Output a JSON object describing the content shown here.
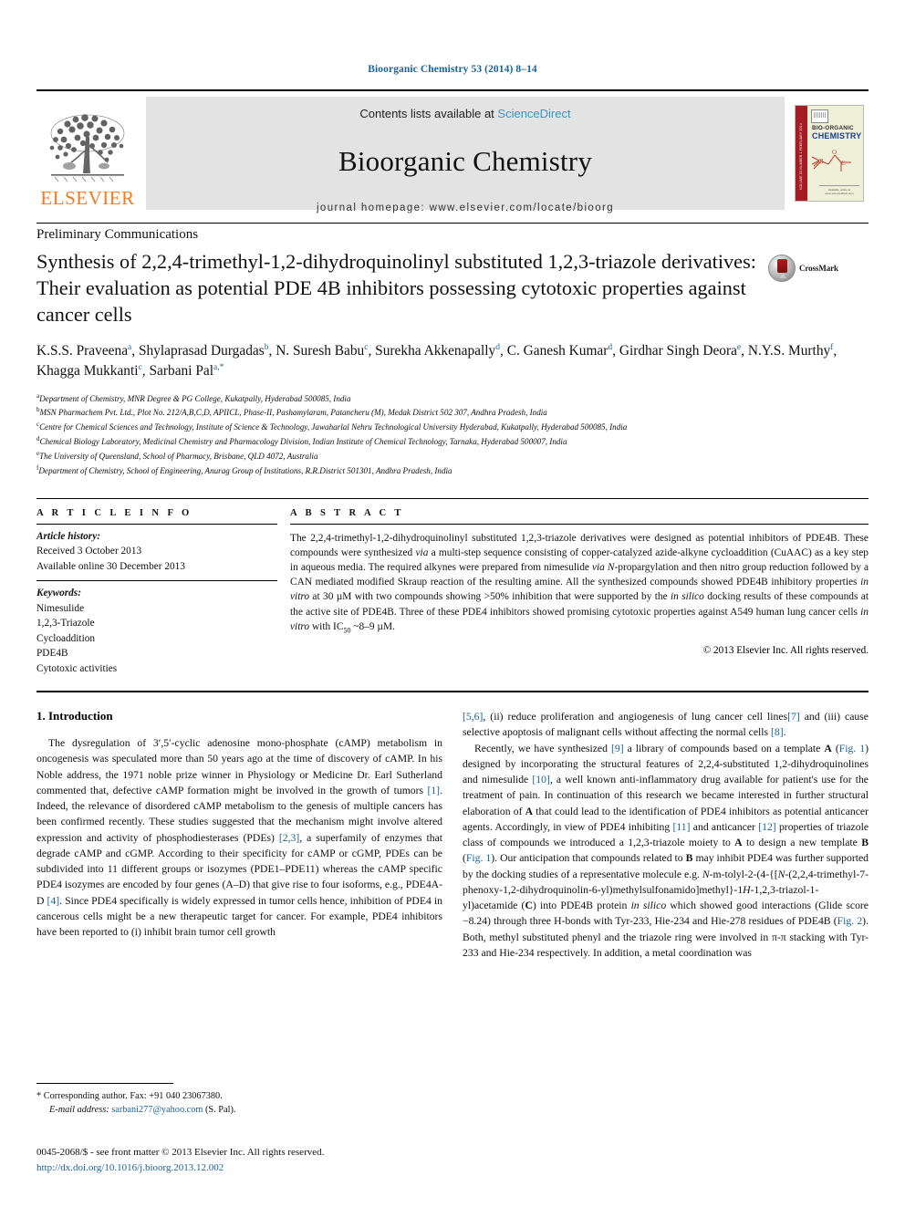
{
  "running_head": "Bioorganic Chemistry 53 (2014) 8–14",
  "masthead": {
    "contents_prefix": "Contents lists available at ",
    "sciencedirect": "ScienceDirect",
    "journal_title": "Bioorganic Chemistry",
    "homepage": "journal homepage: www.elsevier.com/locate/bioorg",
    "publisher_logo_text": "ELSEVIER",
    "cover": {
      "line1": "BIO-ORGANIC",
      "line2": "CHEMISTRY",
      "spine": "VOLUME 53 NUMBER 1 FEBRUARY 2014",
      "footer": "Available online at www.sciencedirect.com"
    }
  },
  "article": {
    "section_type": "Preliminary Communications",
    "title": "Synthesis of 2,2,4-trimethyl-1,2-dihydroquinolinyl substituted 1,2,3-triazole derivatives: Their evaluation as potential PDE 4B inhibitors possessing cytotoxic properties against cancer cells",
    "crossmark_label": "CrossMark",
    "authors": [
      {
        "name": "K.S.S. Praveena",
        "sup": "a"
      },
      {
        "name": "Shylaprasad Durgadas",
        "sup": "b"
      },
      {
        "name": "N. Suresh Babu",
        "sup": "c"
      },
      {
        "name": "Surekha Akkenapally",
        "sup": "d"
      },
      {
        "name": "C. Ganesh Kumar",
        "sup": "d"
      },
      {
        "name": "Girdhar Singh Deora",
        "sup": "e"
      },
      {
        "name": "N.Y.S. Murthy",
        "sup": "f"
      },
      {
        "name": "Khagga Mukkanti",
        "sup": "c"
      },
      {
        "name": "Sarbani Pal",
        "sup": "a,*"
      }
    ],
    "affiliations": [
      {
        "mark": "a",
        "text": "Department of Chemistry, MNR Degree & PG College, Kukatpally, Hyderabad 500085, India"
      },
      {
        "mark": "b",
        "text": "MSN Pharmachem Pvt. Ltd., Plot No. 212/A,B,C,D, APIICL, Phase-II, Pashamylaram, Patancheru (M), Medak District 502 307, Andhra Pradesh, India"
      },
      {
        "mark": "c",
        "text": "Centre for Chemical Sciences and Technology, Institute of Science & Technology, Jawaharlal Nehru Technological University Hyderabad, Kukatpally, Hyderabad 500085, India"
      },
      {
        "mark": "d",
        "text": "Chemical Biology Laboratory, Medicinal Chemistry and Pharmacology Division, Indian Institute of Chemical Technology, Tarnaka, Hyderabad 500007, India"
      },
      {
        "mark": "e",
        "text": "The University of Queensland, School of Pharmacy, Brisbane, QLD 4072, Australia"
      },
      {
        "mark": "f",
        "text": "Department of Chemistry, School of Engineering, Anurag Group of Institutions, R.R.District 501301, Andhra Pradesh, India"
      }
    ]
  },
  "article_info": {
    "header": "A R T I C L E  I N F O",
    "history_label": "Article history:",
    "history": [
      "Received 3 October 2013",
      "Available online 30 December 2013"
    ],
    "keywords_label": "Keywords:",
    "keywords": [
      "Nimesulide",
      "1,2,3-Triazole",
      "Cycloaddition",
      "PDE4B",
      "Cytotoxic activities"
    ]
  },
  "abstract": {
    "header": "A B S T R A C T",
    "text": "The 2,2,4-trimethyl-1,2-dihydroquinolinyl substituted 1,2,3-triazole derivatives were designed as potential inhibitors of PDE4B. These compounds were synthesized via a multi-step sequence consisting of copper-catalyzed azide-alkyne cycloaddition (CuAAC) as a key step in aqueous media. The required alkynes were prepared from nimesulide via N-propargylation and then nitro group reduction followed by a CAN mediated modified Skraup reaction of the resulting amine. All the synthesized compounds showed PDE4B inhibitory properties in vitro at 30 µM with two compounds showing >50% inhibition that were supported by the in silico docking results of these compounds at the active site of PDE4B. Three of these PDE4 inhibitors showed promising cytotoxic properties against A549 human lung cancer cells in vitro with IC50 ~8–9 µM.",
    "rights": "© 2013 Elsevier Inc. All rights reserved."
  },
  "body": {
    "section_heading": "1. Introduction",
    "left_paragraph_1": "The dysregulation of 3′,5′-cyclic adenosine mono-phosphate (cAMP) metabolism in oncogenesis was speculated more than 50 years ago at the time of discovery of cAMP. In his Noble address, the 1971 noble prize winner in Physiology or Medicine Dr. Earl Sutherland commented that, defective cAMP formation might be involved in the growth of tumors [1]. Indeed, the relevance of disordered cAMP metabolism to the genesis of multiple cancers has been confirmed recently. These studies suggested that the mechanism might involve altered expression and activity of phosphodiesterases (PDEs) [2,3], a superfamily of enzymes that degrade cAMP and cGMP. According to their specificity for cAMP or cGMP, PDEs can be subdivided into 11 different groups or isozymes (PDE1–PDE11) whereas the cAMP specific PDE4 isozymes are encoded by four genes (A–D) that give rise to four isoforms, e.g., PDE4A-D [4]. Since PDE4 specifically is widely expressed in tumor cells hence, inhibition of PDE4 in cancerous cells might be a new therapeutic target for cancer. For example, PDE4 inhibitors have been reported to (i) inhibit brain tumor cell growth",
    "right_paragraph_1": "[5,6], (ii) reduce proliferation and angiogenesis of lung cancer cell lines[7] and (iii) cause selective apoptosis of malignant cells without affecting the normal cells [8].",
    "right_paragraph_2": "Recently, we have synthesized [9] a library of compounds based on a template A (Fig. 1) designed by incorporating the structural features of 2,2,4-substituted 1,2-dihydroquinolines and nimesulide [10], a well known anti-inflammatory drug available for patient's use for the treatment of pain. In continuation of this research we became interested in further structural elaboration of A that could lead to the identification of PDE4 inhibitors as potential anticancer agents. Accordingly, in view of PDE4 inhibiting [11] and anticancer [12] properties of triazole class of compounds we introduced a 1,2,3-triazole moiety to A to design a new template B (Fig. 1). Our anticipation that compounds related to B may inhibit PDE4 was further supported by the docking studies of a representative molecule e.g. N-m-tolyl-2-(4-{[N-(2,2,4-trimethyl-7-phenoxy-1,2-dihydroquinolin-6-yl)methylsulfonamido]methyl}-1H-1,2,3-triazol-1-yl)acetamide (C) into PDE4B protein in silico which showed good interactions (Glide score −8.24) through three H-bonds with Tyr-233, Hie-234 and Hie-278 residues of PDE4B (Fig. 2). Both, methyl substituted phenyl and the triazole ring were involved in π-π stacking with Tyr-233 and Hie-234 respectively. In addition, a metal coordination was"
  },
  "footnote": {
    "star": "*",
    "corresponding": "Corresponding author. Fax: +91 040 23067380.",
    "email_label": "E-mail address:",
    "email": "sarbani277@yahoo.com",
    "email_suffix": "(S. Pal)."
  },
  "footer": {
    "issn_line": "0045-2068/$ - see front matter © 2013 Elsevier Inc. All rights reserved.",
    "doi": "http://dx.doi.org/10.1016/j.bioorg.2013.12.002"
  },
  "colors": {
    "link": "#1a6496",
    "elsevier_orange": "#f47920",
    "masthead_bg": "#e3e3e3"
  }
}
